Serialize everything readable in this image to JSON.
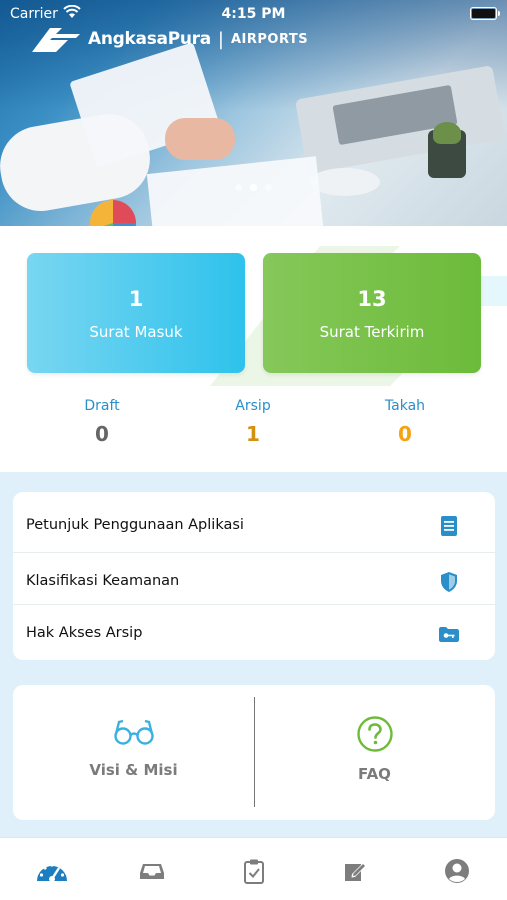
{
  "status_bar": {
    "carrier": "Carrier",
    "time": "4:15 PM"
  },
  "header": {
    "brand_name": "AngkasaPura",
    "brand_separator": "|",
    "brand_suffix": "AIRPORTS",
    "carousel_pages": 3,
    "carousel_active_index": 1
  },
  "cards": [
    {
      "count": "1",
      "label": "Surat Masuk",
      "color": "#2ec2ec"
    },
    {
      "count": "13",
      "label": "Surat Terkirim",
      "color": "#6cbb3a"
    }
  ],
  "counters": [
    {
      "label": "Draft",
      "value": "0"
    },
    {
      "label": "Arsip",
      "value": "1"
    },
    {
      "label": "Takah",
      "value": "0"
    }
  ],
  "menu": [
    {
      "label": "Petunjuk Penggunaan Aplikasi",
      "icon": "book-icon"
    },
    {
      "label": "Klasifikasi Keamanan",
      "icon": "shield-icon"
    },
    {
      "label": "Hak Akses Arsip",
      "icon": "folder-key-icon"
    }
  ],
  "quick_actions": [
    {
      "label": "Visi & Misi",
      "icon": "glasses-icon"
    },
    {
      "label": "FAQ",
      "icon": "question-circle-icon"
    }
  ],
  "tabs": [
    {
      "icon": "dashboard-icon",
      "active": true
    },
    {
      "icon": "inbox-icon",
      "active": false
    },
    {
      "icon": "clipboard-check-icon",
      "active": false
    },
    {
      "icon": "compose-icon",
      "active": false
    },
    {
      "icon": "profile-icon",
      "active": false
    }
  ],
  "colors": {
    "accent": "#2a8fc9",
    "lower_bg": "#dff0fa",
    "active_tab": "#1c7dc0",
    "inactive_tab": "#7d7d7d"
  }
}
